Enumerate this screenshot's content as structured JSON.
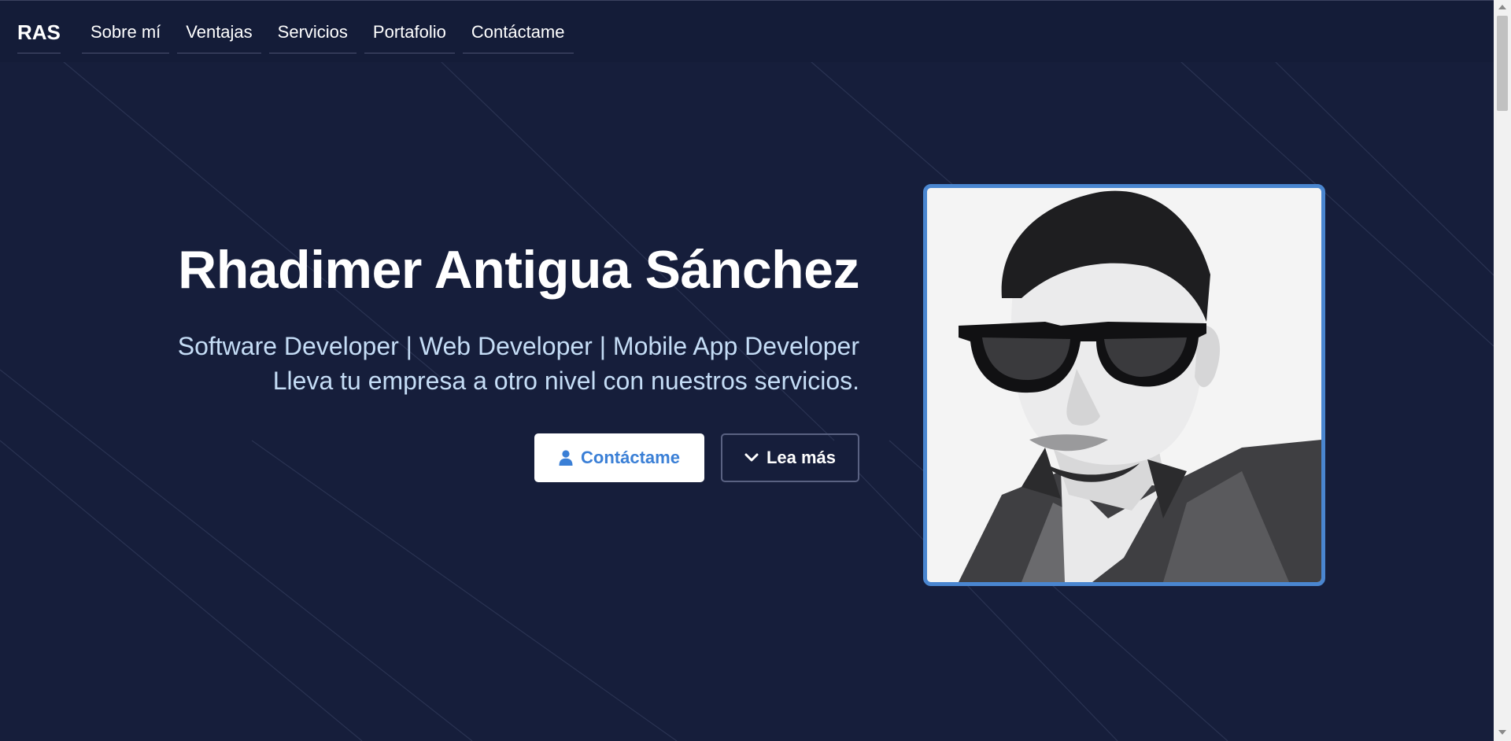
{
  "nav": {
    "brand": "RAS",
    "links": [
      "Sobre mí",
      "Ventajas",
      "Servicios",
      "Portafolio",
      "Contáctame"
    ]
  },
  "hero": {
    "title": "Rhadimer Antigua Sánchez",
    "subtitle_line1": "Software Developer | Web Developer | Mobile App Developer",
    "subtitle_line2": "Lleva tu empresa a otro nivel con nuestros servicios.",
    "primary_button": "Contáctame",
    "secondary_button": "Lea más"
  },
  "portrait": {
    "image_name": "profile-photo",
    "border_color": "#4a86d0"
  },
  "colors": {
    "background": "#161e3b",
    "accent": "#3a7fd6",
    "subtitle": "#c5ddf6"
  },
  "icons": {
    "contact": "user-icon",
    "more": "chevron-down-icon"
  }
}
